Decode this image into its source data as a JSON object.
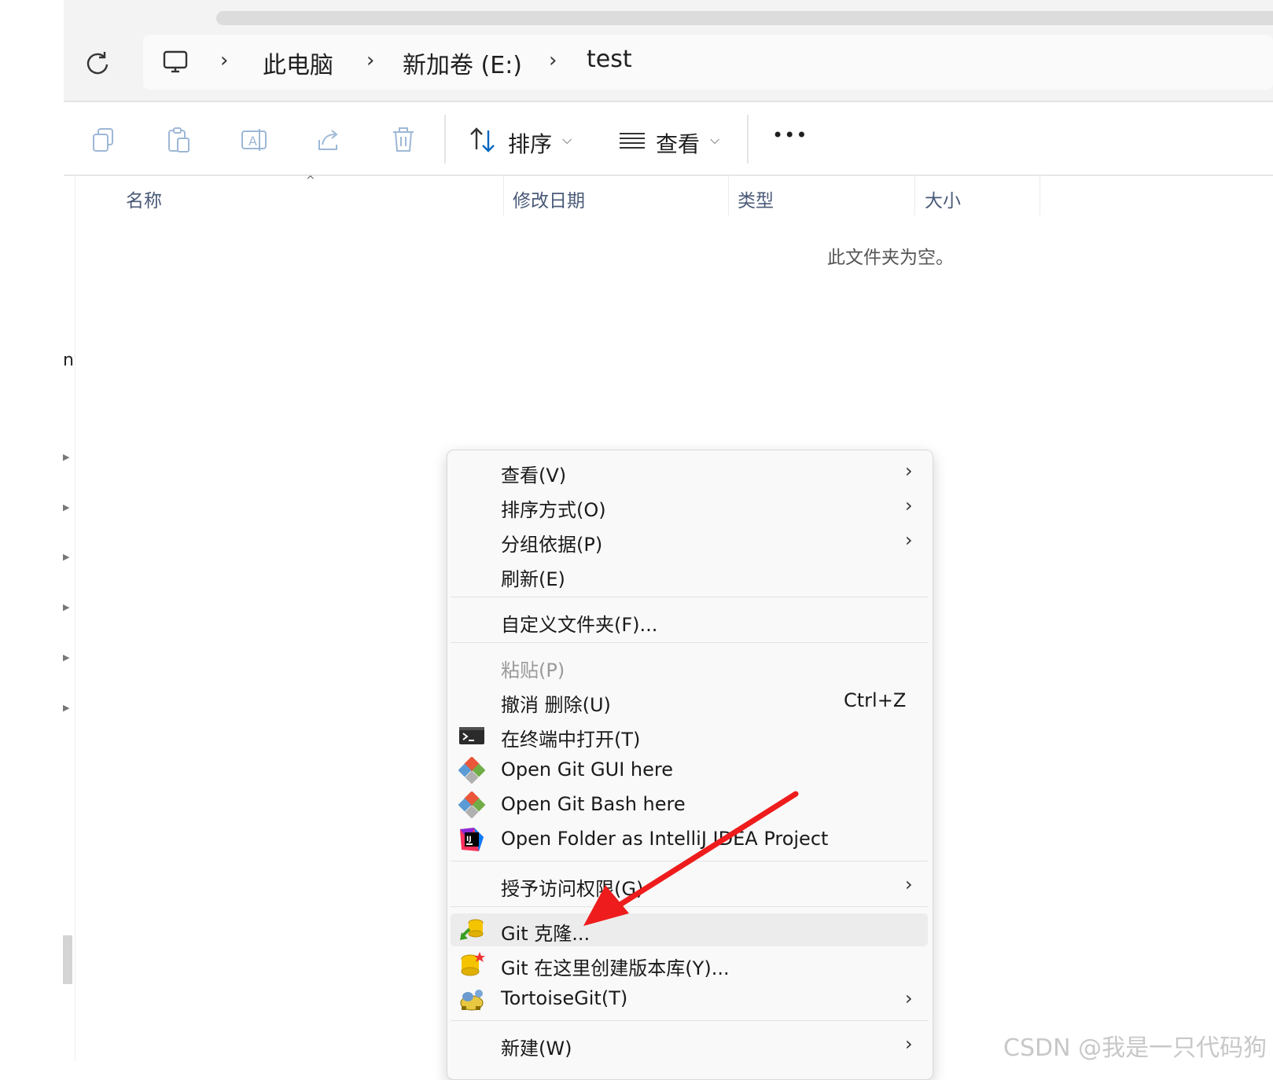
{
  "address": {
    "crumbs": [
      "此电脑",
      "新加卷 (E:)",
      "test"
    ]
  },
  "toolbar": {
    "sort_label": "排序",
    "view_label": "查看",
    "more_label": "•••"
  },
  "columns": [
    "名称",
    "修改日期",
    "类型",
    "大小"
  ],
  "empty_message": "此文件夹为空。",
  "nav": {
    "partial_label": "n"
  },
  "context_menu": {
    "items": [
      {
        "label": "查看(V)",
        "submenu": true
      },
      {
        "label": "排序方式(O)",
        "submenu": true
      },
      {
        "label": "分组依据(P)",
        "submenu": true
      },
      {
        "label": "刷新(E)"
      },
      {
        "label": "自定义文件夹(F)..."
      },
      {
        "label": "粘贴(P)",
        "disabled": true
      },
      {
        "label": "撤消 删除(U)",
        "shortcut": "Ctrl+Z"
      },
      {
        "label": "在终端中打开(T)",
        "icon": "terminal-icon"
      },
      {
        "label": "Open Git GUI here",
        "icon": "git-icon"
      },
      {
        "label": "Open Git Bash here",
        "icon": "git-icon"
      },
      {
        "label": "Open Folder as IntelliJ IDEA Project",
        "icon": "intellij-icon"
      },
      {
        "label": "授予访问权限(G)",
        "submenu": true
      },
      {
        "label": "Git 克隆...",
        "icon": "git-clone-icon",
        "highlighted": true
      },
      {
        "label": "Git 在这里创建版本库(Y)...",
        "icon": "git-create-repo-icon"
      },
      {
        "label": "TortoiseGit(T)",
        "icon": "tortoisegit-icon",
        "submenu": true
      },
      {
        "label": "新建(W)",
        "submenu": true
      }
    ],
    "submenu_arrow": "›"
  },
  "annotation": {
    "color": "#ee1c1c"
  },
  "watermark": "CSDN @我是一只代码狗",
  "colors": {
    "accent": "#0067c0",
    "highlight": "#ececec",
    "arrow": "#ee1c1c"
  }
}
